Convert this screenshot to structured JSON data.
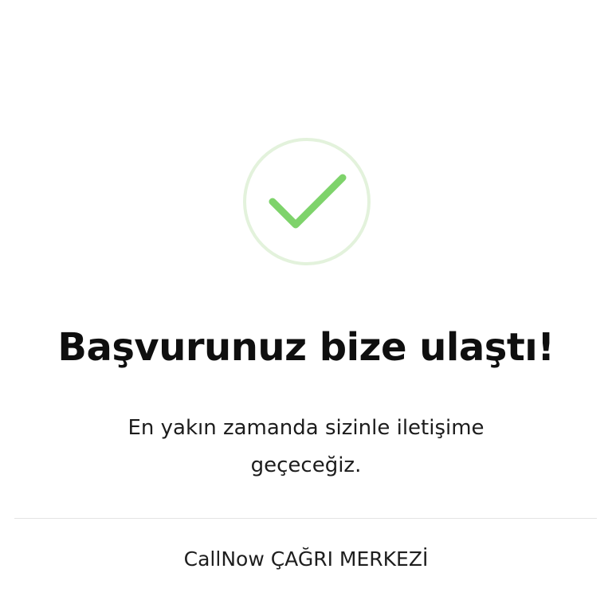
{
  "success": {
    "icon": "check-circle-icon",
    "ring_color": "#e3f2dc",
    "check_color": "#7ed36b"
  },
  "title": "Başvurunuz bize ulaştı!",
  "message": "En yakın zamanda sizinle iletişime geçeceğiz.",
  "footer": {
    "call_center_label": "CallNow ÇAĞRI MERKEZİ"
  }
}
